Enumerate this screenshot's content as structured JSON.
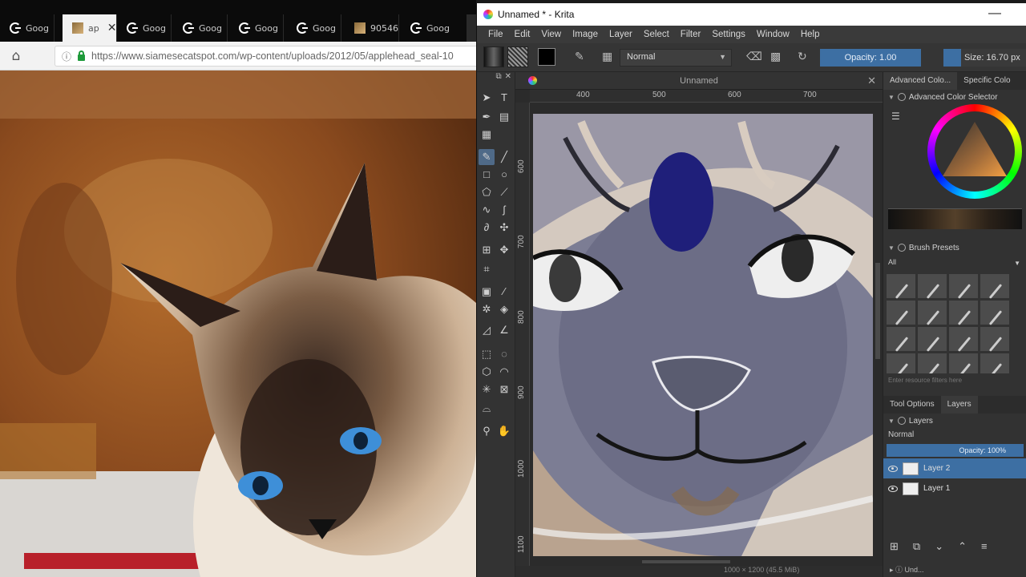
{
  "browser": {
    "tabs": [
      {
        "label": "Goog",
        "icon": "google-icon"
      },
      {
        "label": "ap",
        "icon": "image-favicon",
        "active": true
      },
      {
        "label": "Goog",
        "icon": "google-icon"
      },
      {
        "label": "Goog",
        "icon": "google-icon"
      },
      {
        "label": "Goog",
        "icon": "google-icon"
      },
      {
        "label": "Goog",
        "icon": "google-icon"
      },
      {
        "label": "90546",
        "icon": "image-favicon"
      },
      {
        "label": "Goog",
        "icon": "google-icon"
      }
    ],
    "url": "https://www.siamesecatspot.com/wp-content/uploads/2012/05/applehead_seal-10"
  },
  "krita": {
    "window_title": "Unnamed * - Krita",
    "menu": [
      "File",
      "Edit",
      "View",
      "Image",
      "Layer",
      "Select",
      "Filter",
      "Settings",
      "Window",
      "Help"
    ],
    "blend_mode": "Normal",
    "opacity_label": "Opacity: 1.00",
    "size_label": "Size: 16.70 px",
    "document_tab": "Unnamed",
    "ruler_h": [
      "400",
      "500",
      "600",
      "700"
    ],
    "ruler_v": [
      "600",
      "700",
      "800",
      "900",
      "1000",
      "1100"
    ],
    "status": "1000 × 1200 (45.5 MiB)",
    "dock": {
      "color_tabs": [
        "Advanced Colo...",
        "Specific Colo"
      ],
      "color_selector_title": "Advanced Color Selector",
      "brush_presets_title": "Brush Presets",
      "preset_filter": "All",
      "preset_search_placeholder": "Enter resource filters here",
      "layer_tabs": [
        "Tool Options",
        "Layers"
      ],
      "layers_title": "Layers",
      "layers_mode": "Normal",
      "layers_opacity": "Opacity:  100%",
      "layers": [
        {
          "name": "Layer 2",
          "active": true
        },
        {
          "name": "Layer 1",
          "active": false
        }
      ],
      "bottom_docker": "Und..."
    },
    "accent_color": "#3d6fa3"
  }
}
